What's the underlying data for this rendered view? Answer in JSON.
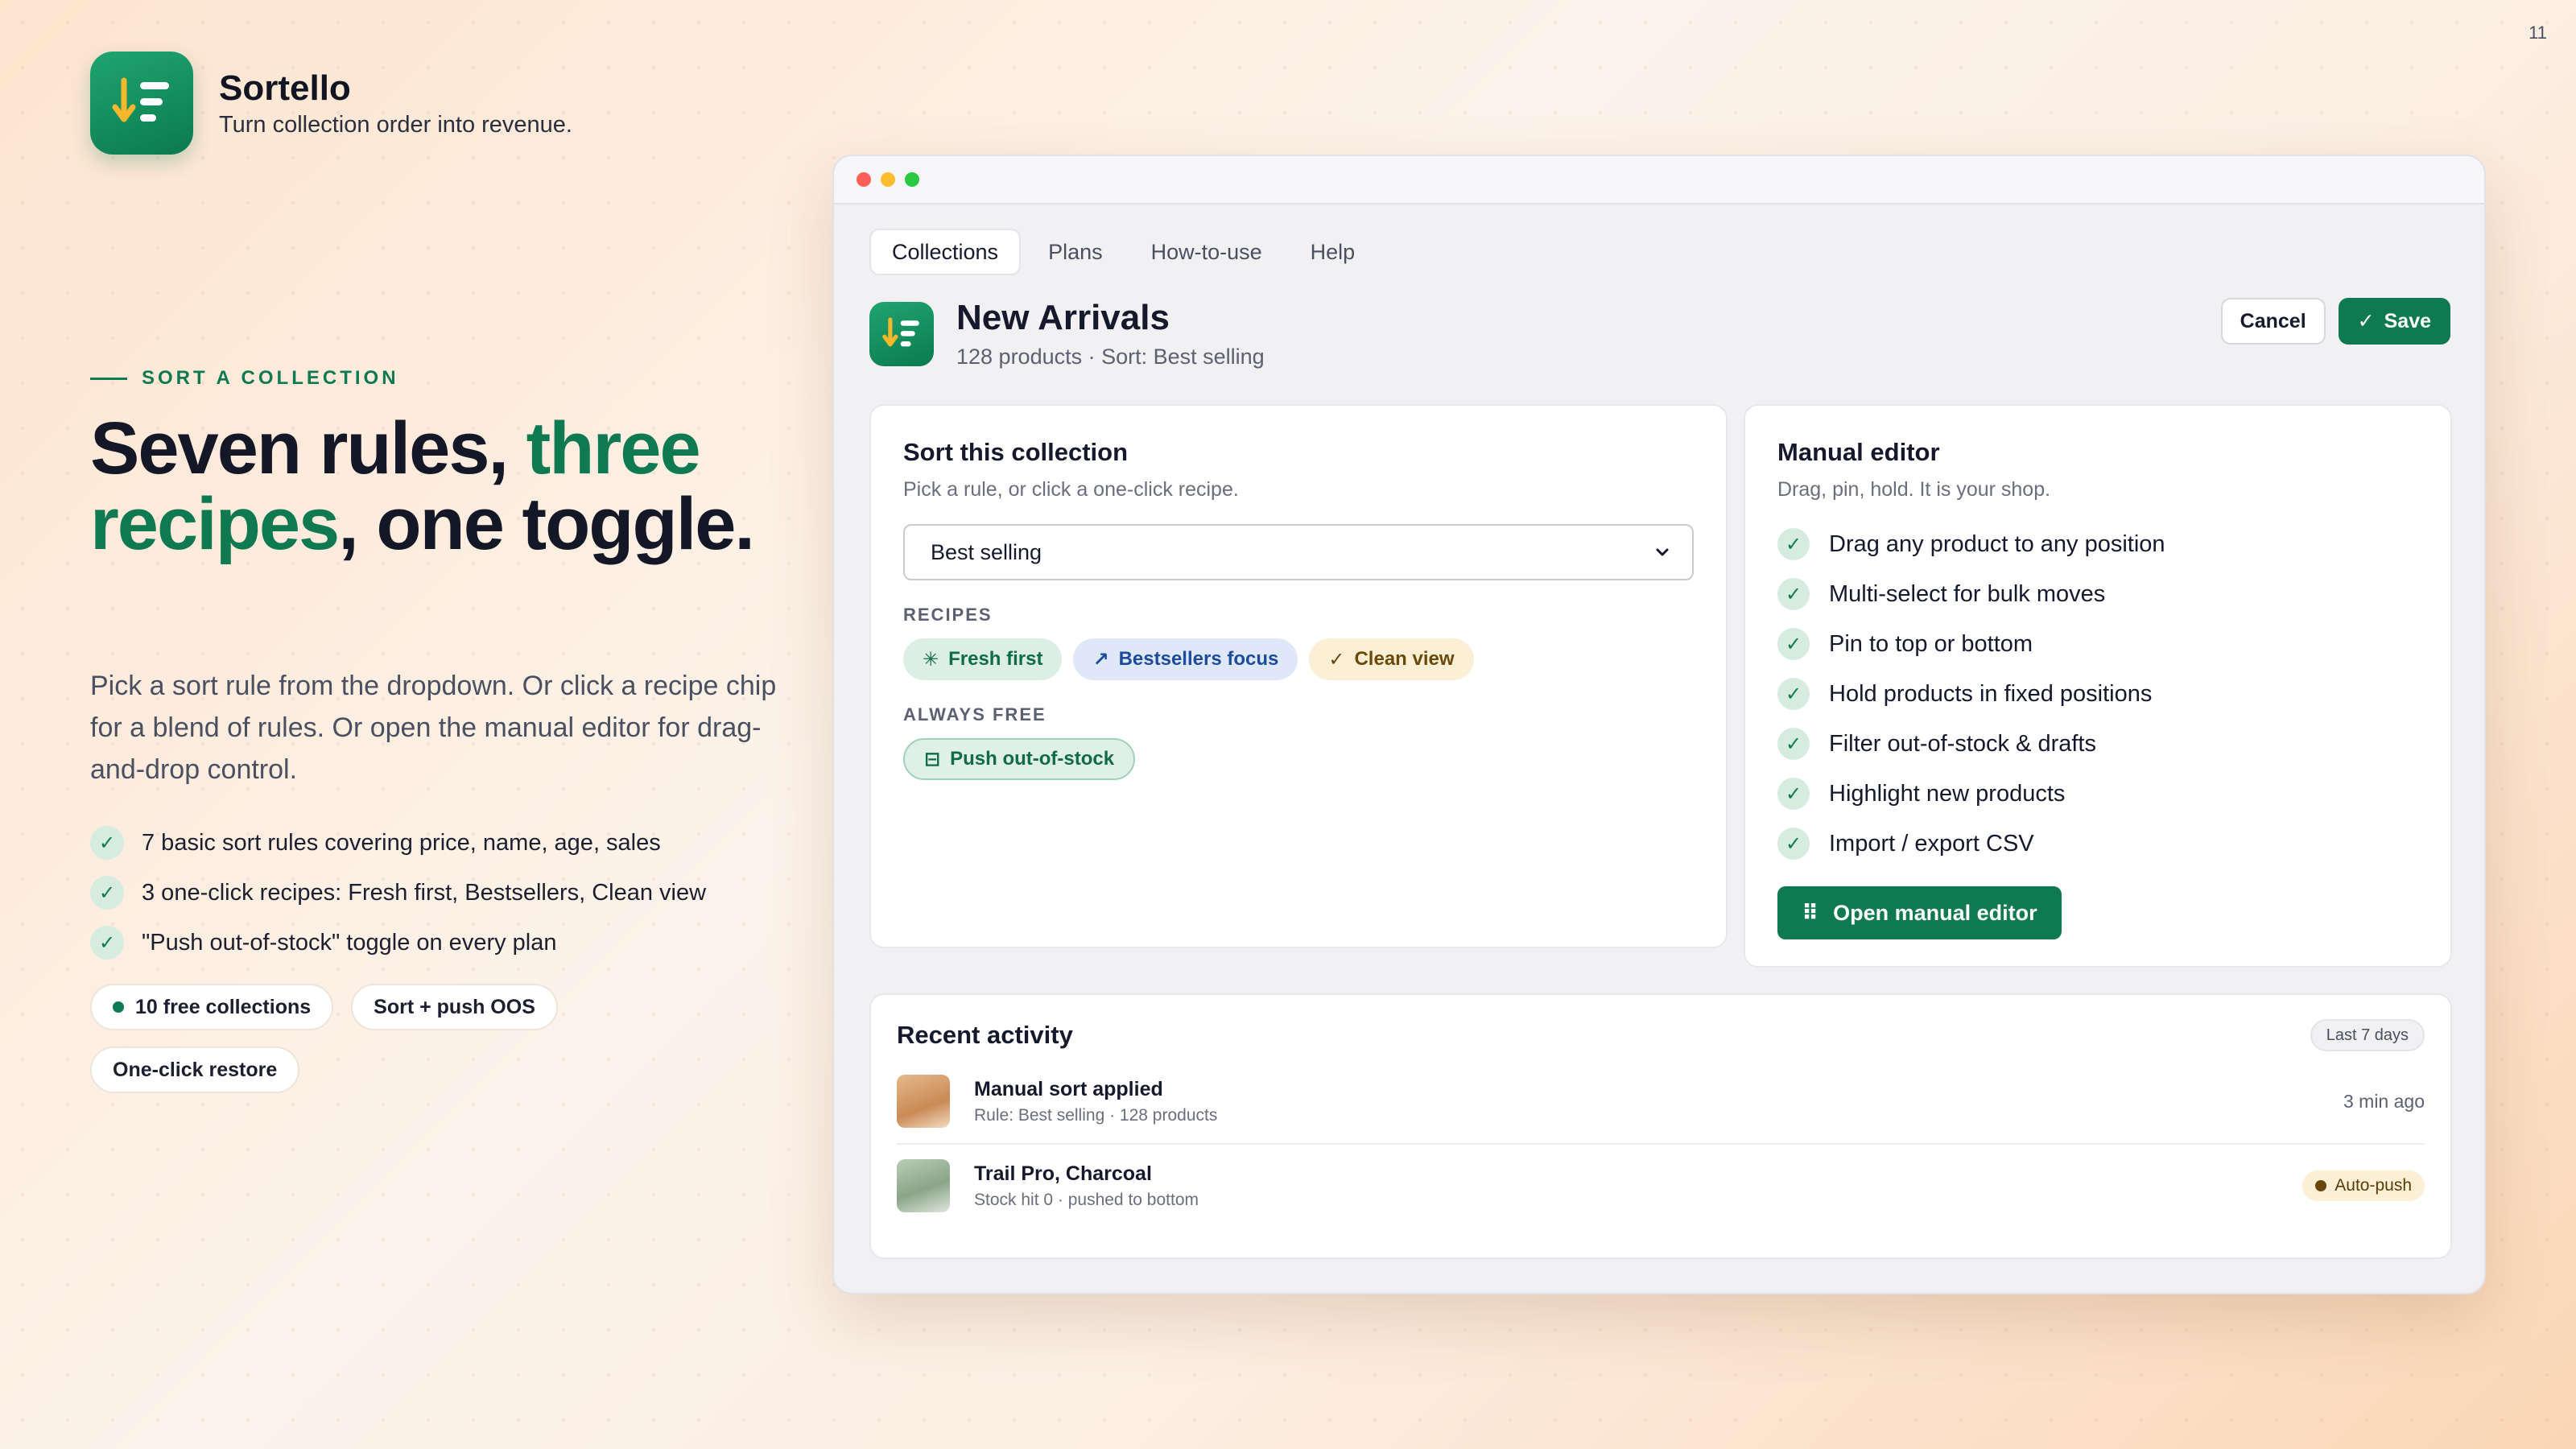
{
  "slide_number": "11",
  "brand": {
    "name": "Sortello",
    "tagline": "Turn collection order into revenue."
  },
  "colors": {
    "accent": "#0f7a52",
    "text": "#15192b",
    "muted": "#6a6e7d"
  },
  "hero": {
    "eyebrow": "SORT A COLLECTION",
    "headline_part1": "Seven rules, ",
    "headline_accent": "three recipes",
    "headline_part2": ", one toggle.",
    "lede": "Pick a sort rule from the dropdown. Or click a recipe chip for a blend of rules. Or open the manual editor for drag-and-drop control.",
    "bullets": [
      "7 basic sort rules covering price, name, age, sales",
      "3 one-click recipes: Fresh first, Bestsellers, Clean view",
      "\"Push out-of-stock\" toggle on every plan"
    ],
    "pills": [
      "10 free collections",
      "Sort + push OOS",
      "One-click restore"
    ]
  },
  "app": {
    "tabs": [
      "Collections",
      "Plans",
      "How-to-use",
      "Help"
    ],
    "active_tab": "Collections",
    "page_title": "New Arrivals",
    "page_subtitle": "128 products · Sort: Best selling",
    "cancel_label": "Cancel",
    "save_label": "Save",
    "sort_card": {
      "title": "Sort this collection",
      "subtitle": "Pick a rule, or click a one-click recipe.",
      "selected_rule": "Best selling",
      "recipes_label": "RECIPES",
      "recipes": [
        "Fresh first",
        "Bestsellers focus",
        "Clean view"
      ],
      "free_label": "ALWAYS FREE",
      "free_chip": "Push out-of-stock"
    },
    "manual_card": {
      "title": "Manual editor",
      "subtitle": "Drag, pin, hold. It is your shop.",
      "features": [
        "Drag any product to any position",
        "Multi-select for bulk moves",
        "Pin to top or bottom",
        "Hold products in fixed positions",
        "Filter out-of-stock & drafts",
        "Highlight new products",
        "Import / export CSV"
      ],
      "open_label": "Open manual editor"
    },
    "activity": {
      "title": "Recent activity",
      "period": "Last 7 days",
      "rows": [
        {
          "title": "Manual sort applied",
          "subtitle": "Rule: Best selling · 128 products",
          "meta": "3 min ago"
        },
        {
          "title": "Trail Pro, Charcoal",
          "subtitle": "Stock hit 0 · pushed to bottom",
          "meta": "Auto-push"
        }
      ]
    }
  }
}
